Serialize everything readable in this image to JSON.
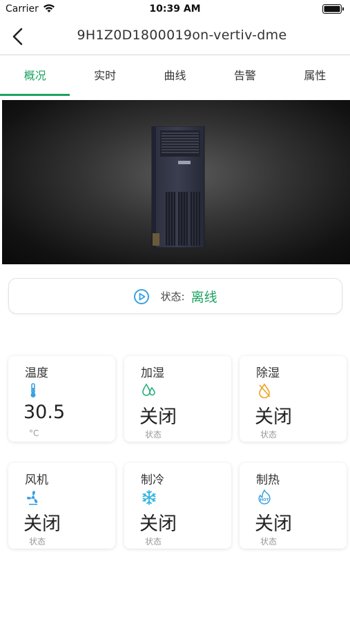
{
  "status_bar": {
    "carrier": "Carrier",
    "time": "10:39 AM"
  },
  "nav": {
    "title": "9H1Z0D1800019on-vertiv-dme"
  },
  "tabs": [
    {
      "label": "概况",
      "active": true
    },
    {
      "label": "实时",
      "active": false
    },
    {
      "label": "曲线",
      "active": false
    },
    {
      "label": "告警",
      "active": false
    },
    {
      "label": "属性",
      "active": false
    }
  ],
  "status": {
    "label": "状态:",
    "value": "离线"
  },
  "cards": [
    {
      "title": "温度",
      "icon": "thermometer-icon",
      "value": "30.5",
      "sub": "°C"
    },
    {
      "title": "加湿",
      "icon": "water-drops-icon",
      "value": "关闭",
      "sub": "状态"
    },
    {
      "title": "除湿",
      "icon": "no-drop-icon",
      "value": "关闭",
      "sub": "状态"
    },
    {
      "title": "风机",
      "icon": "fan-icon",
      "value": "关闭",
      "sub": "状态"
    },
    {
      "title": "制冷",
      "icon": "snowflake-icon",
      "value": "关闭",
      "sub": "状态"
    },
    {
      "title": "制热",
      "icon": "hot-icon",
      "value": "关闭",
      "sub": "状态"
    }
  ],
  "colors": {
    "accent": "#1aa260",
    "icon_blue": "#3aa0e0",
    "icon_green": "#2bb07a",
    "icon_orange": "#f0a020"
  }
}
